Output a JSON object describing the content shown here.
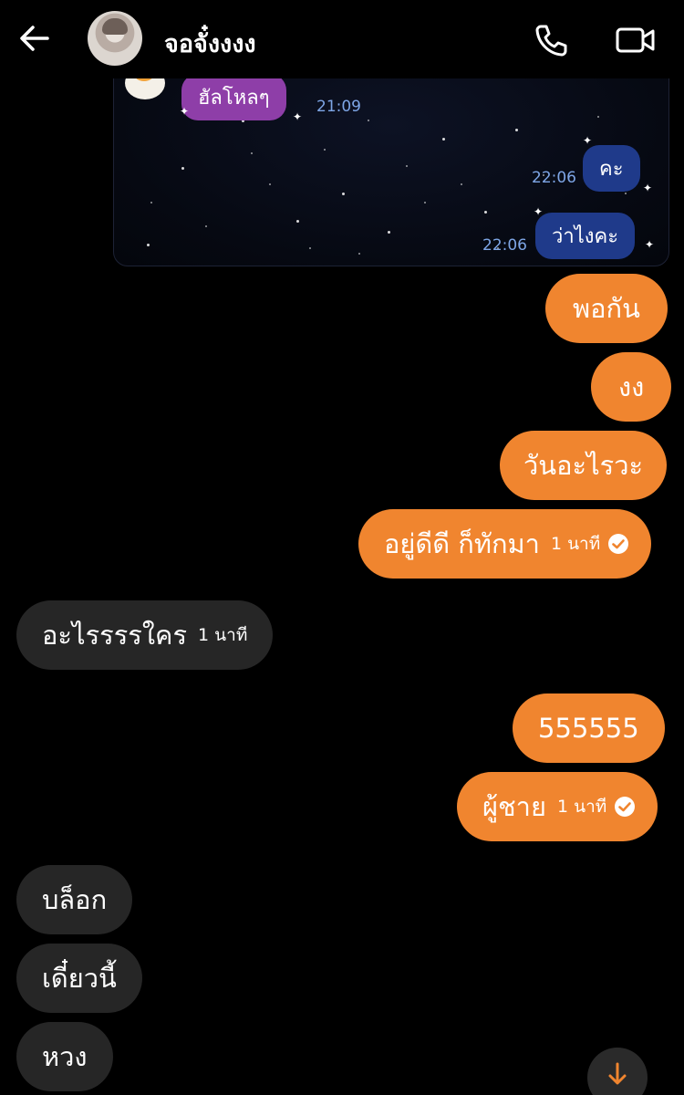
{
  "header": {
    "contact_name": "จอจั๋งงงง"
  },
  "shared_image": {
    "messages": [
      {
        "text": "ฮัลโหลๆ",
        "time": "21:09"
      },
      {
        "text": "คะ",
        "time": "22:06"
      },
      {
        "text": "ว่าไงคะ",
        "time": "22:06"
      }
    ]
  },
  "messages": [
    {
      "text": "พอกัน"
    },
    {
      "text": "งง"
    },
    {
      "text": "วันอะไรวะ"
    },
    {
      "text": "อยู่ดีดี ก็ทักมา",
      "time": "1 นาที"
    },
    {
      "text": "อะไรรรรใคร",
      "time": "1 นาที"
    },
    {
      "text": "555555"
    },
    {
      "text": "ผู้ชาย",
      "time": "1 นาที"
    },
    {
      "text": "บล็อก"
    },
    {
      "text": "เดี๋ยวนี้"
    },
    {
      "text": "หวง"
    }
  ],
  "colors": {
    "outgoing": "#f0852f",
    "incoming": "#262626",
    "background": "#000000"
  },
  "icons": [
    "back-arrow-icon",
    "phone-icon",
    "video-camera-icon",
    "seen-check-icon",
    "arrow-down-icon"
  ]
}
